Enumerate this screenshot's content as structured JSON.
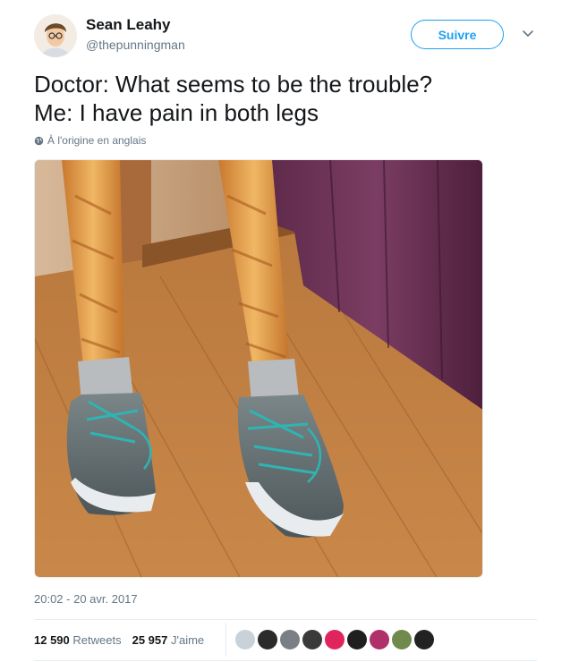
{
  "user": {
    "display_name": "Sean Leahy",
    "handle": "@thepunningman"
  },
  "follow_label": "Suivre",
  "tweet_text": "Doctor: What seems to be the trouble?\nMe: I have pain in both legs",
  "translate_label": "À l'origine en anglais",
  "timestamp": "20:02 - 20 avr. 2017",
  "stats": {
    "retweets_count": "12 590",
    "retweets_label": "Retweets",
    "likes_count": "25 957",
    "likes_label": "J'aime"
  },
  "likers": [
    {
      "color": "#c9d1d9"
    },
    {
      "color": "#2b2b2b"
    },
    {
      "color": "#7a7f86"
    },
    {
      "color": "#3a3a3a"
    },
    {
      "color": "#e0245e"
    },
    {
      "color": "#1f1f1f"
    },
    {
      "color": "#b0306a"
    },
    {
      "color": "#6f8a4c"
    },
    {
      "color": "#222222"
    }
  ],
  "colors": {
    "accent": "#1da1f2",
    "muted": "#657786",
    "text": "#14171a"
  }
}
